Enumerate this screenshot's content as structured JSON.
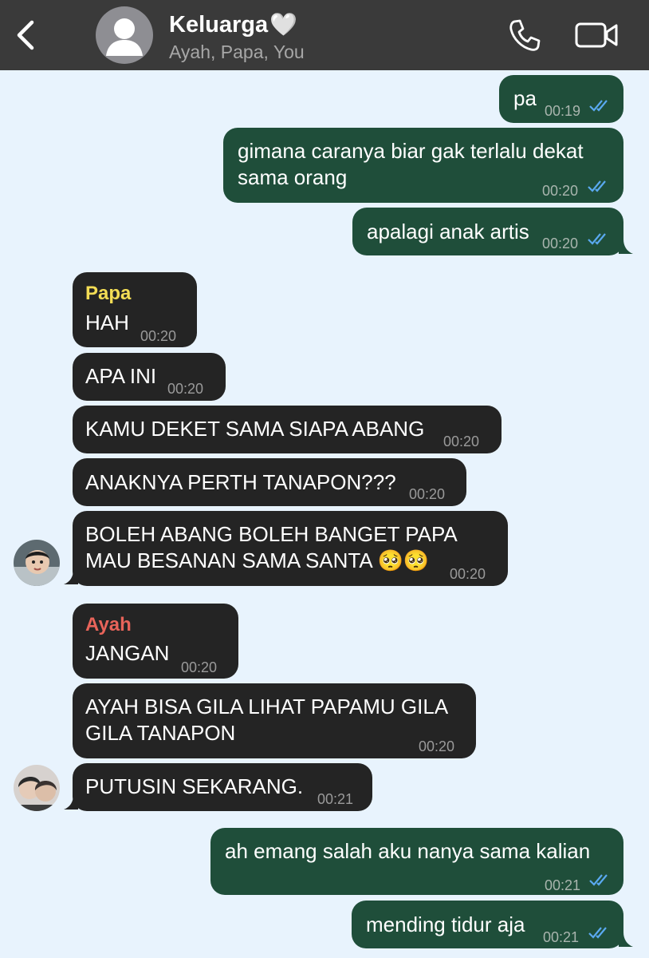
{
  "header": {
    "title": "Keluarga",
    "title_emoji": "🤍",
    "members": "Ayah, Papa, You"
  },
  "colors": {
    "outgoing_bubble": "#1f4e3a",
    "incoming_bubble": "#242424",
    "chat_background": "#e8f3fd",
    "read_ticks": "#5aa9f0",
    "sender_papa": "#f3dd55",
    "sender_ayah": "#e8645a"
  },
  "messages": [
    {
      "from": "You",
      "text": "pa",
      "time": "00:19",
      "status": "read"
    },
    {
      "from": "You",
      "lines": [
        "gimana caranya biar gak terlalu dekat",
        "sama orang"
      ],
      "time": "00:20",
      "status": "read"
    },
    {
      "from": "You",
      "text": "apalagi anak artis",
      "time": "00:20",
      "status": "read"
    },
    {
      "from": "Papa",
      "sender_label": "Papa",
      "text": "HAH",
      "time": "00:20"
    },
    {
      "from": "Papa",
      "text": "APA INI",
      "time": "00:20"
    },
    {
      "from": "Papa",
      "text": "KAMU DEKET SAMA SIAPA ABANG",
      "time": "00:20"
    },
    {
      "from": "Papa",
      "text": "ANAKNYA PERTH TANAPON???",
      "time": "00:20"
    },
    {
      "from": "Papa",
      "lines": [
        "BOLEH ABANG BOLEH BANGET PAPA",
        "MAU BESANAN SAMA SANTA 🥺🥺"
      ],
      "time": "00:20"
    },
    {
      "from": "Ayah",
      "sender_label": "Ayah",
      "text": "JANGAN",
      "time": "00:20"
    },
    {
      "from": "Ayah",
      "lines": [
        "AYAH BISA GILA LIHAT PAPAMU GILA",
        "GILA TANAPON"
      ],
      "time": "00:20"
    },
    {
      "from": "Ayah",
      "text": "PUTUSIN SEKARANG.",
      "time": "00:21"
    },
    {
      "from": "You",
      "text": "ah emang salah aku nanya sama kalian",
      "time": "00:21",
      "status": "read"
    },
    {
      "from": "You",
      "text": "mending tidur aja",
      "time": "00:21",
      "status": "read"
    }
  ]
}
